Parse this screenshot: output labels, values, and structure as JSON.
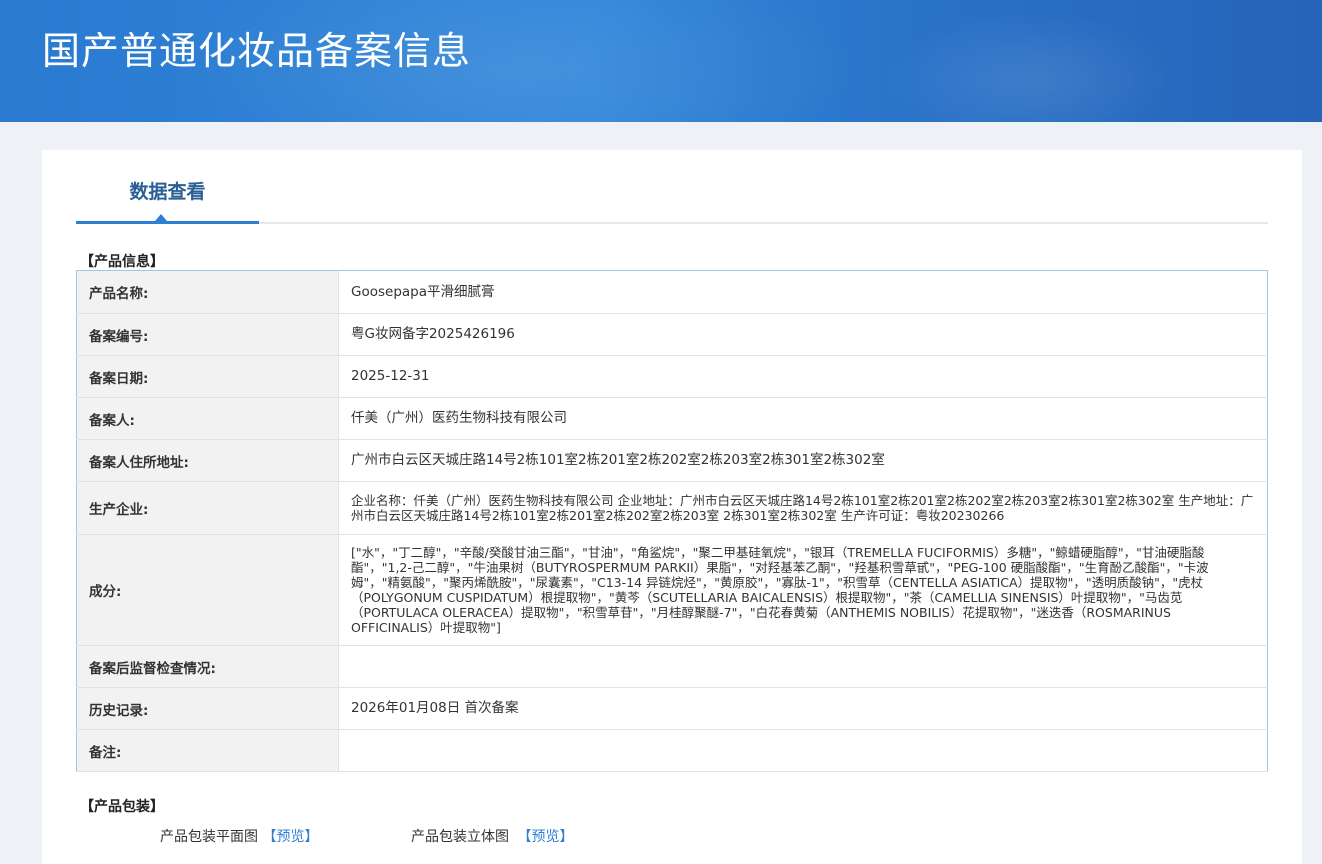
{
  "header": {
    "title": "国产普通化妆品备案信息"
  },
  "tabs": [
    {
      "label": "数据查看"
    }
  ],
  "product_info": {
    "section_title": "【产品信息】",
    "rows": [
      {
        "key": "产品名称:",
        "value": "Goosepapa平滑细腻膏"
      },
      {
        "key": "备案编号:",
        "value": "粤G妆网备字2025426196"
      },
      {
        "key": "备案日期:",
        "value": "2025-12-31"
      },
      {
        "key": "备案人:",
        "value": "仟美（广州）医药生物科技有限公司"
      },
      {
        "key": "备案人住所地址:",
        "value": "广州市白云区天城庄路14号2栋101室2栋201室2栋202室2栋203室2栋301室2栋302室"
      },
      {
        "key": "生产企业:",
        "value": "企业名称：仟美（广州）医药生物科技有限公司 企业地址：广州市白云区天城庄路14号2栋101室2栋201室2栋202室2栋203室2栋301室2栋302室 生产地址：广州市白云区天城庄路14号2栋101室2栋201室2栋202室2栋203室 2栋301室2栋302室 生产许可证：粤妆20230266"
      },
      {
        "key": "成分:",
        "value": "[\"水\"，\"丁二醇\"，\"辛酸/癸酸甘油三酯\"，\"甘油\"，\"角鲨烷\"，\"聚二甲基硅氧烷\"，\"银耳（TREMELLA FUCIFORMIS）多糖\"，\"鲸蜡硬脂醇\"，\"甘油硬脂酸酯\"，\"1,2-己二醇\"，\"牛油果树（BUTYROSPERMUM PARKII）果脂\"，\"对羟基苯乙酮\"，\"羟基积雪草甙\"，\"PEG-100 硬脂酸酯\"，\"生育酚乙酸酯\"，\"卡波姆\"，\"精氨酸\"，\"聚丙烯酰胺\"，\"尿囊素\"，\"C13-14 异链烷烃\"，\"黄原胶\"，\"寡肽-1\"，\"积雪草（CENTELLA ASIATICA）提取物\"，\"透明质酸钠\"，\"虎杖（POLYGONUM CUSPIDATUM）根提取物\"，\"黄芩（SCUTELLARIA BAICALENSIS）根提取物\"，\"茶（CAMELLIA SINENSIS）叶提取物\"，\"马齿苋（PORTULACA OLERACEA）提取物\"，\"积雪草苷\"，\"月桂醇聚醚-7\"，\"白花春黄菊（ANTHEMIS NOBILIS）花提取物\"，\"迷迭香（ROSMARINUS OFFICINALIS）叶提取物\"]"
      },
      {
        "key": "备案后监督检查情况:",
        "value": ""
      },
      {
        "key": "历史记录:",
        "value": "2026年01月08日 首次备案"
      },
      {
        "key": "备注:",
        "value": ""
      }
    ]
  },
  "packaging": {
    "section_title": "【产品包装】",
    "flat_label": "产品包装平面图",
    "flat_link": "【预览】",
    "solid_label": "产品包装立体图",
    "solid_link": "【预览】"
  }
}
